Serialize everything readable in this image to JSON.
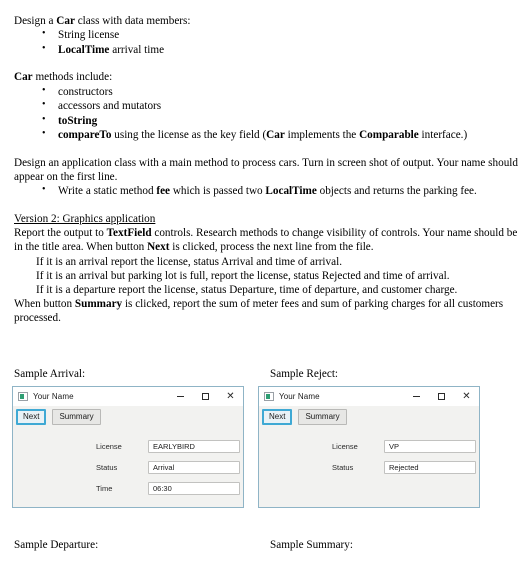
{
  "document": {
    "intro_line": "Design a Car class with data members:",
    "intro_strong": "Car",
    "data_members": [
      {
        "pre": "",
        "strong": "String",
        "post": " license",
        "plain": "String license"
      },
      {
        "strong": "LocalTime",
        "post": " arrival time",
        "plain": "LocalTime arrival time"
      }
    ],
    "methods_heading_strong": "Car",
    "methods_heading": "Car methods include:",
    "methods": [
      {
        "plain": "constructors"
      },
      {
        "plain": "accessors and mutators"
      },
      {
        "plain": "toString"
      },
      {
        "plain": "compareTo using the license as the key field  (Car implements the Comparable interface.)"
      }
    ],
    "app_paragraph": "Design an application class with a main method to process cars. Turn in screen shot of output.  Your name should appear on the first line.",
    "fee_bullet": "Write a static method fee which is passed two LocalTime objects and returns the parking fee.",
    "version2_heading": "Version 2:  Graphics application",
    "version2_para1": "Report the output to TextField controls.  Research methods to change visibility of controls.  Your name should be in the title area. When button Next is clicked, process the next line from the file.",
    "version2_rules": [
      "If it is an arrival report the license, status Arrival and time of arrival.",
      "If it is an arrival but parking lot is full, report the license, status Rejected and time of arrival.",
      "If it is a departure report the license, status Departure, time of departure, and customer charge."
    ],
    "version2_para2": "When button Summary is clicked, report the sum of meter fees and sum of parking charges for all customers processed."
  },
  "captions": {
    "arrival": "Sample Arrival:",
    "reject": "Sample Reject:",
    "departure": "Sample Departure:",
    "summary": "Sample Summary:"
  },
  "windows": {
    "arrival": {
      "title": "Your Name",
      "icon": "app-icon",
      "controls": {
        "minimize": "—",
        "maximize": "□",
        "close": "✕"
      },
      "buttons": {
        "next": "Next",
        "summary": "Summary"
      },
      "fields": [
        {
          "label": "License",
          "value": "EARLYBIRD"
        },
        {
          "label": "Status",
          "value": "Arrival"
        },
        {
          "label": "Time",
          "value": "06:30"
        }
      ]
    },
    "reject": {
      "title": "Your Name",
      "icon": "app-icon",
      "controls": {
        "minimize": "—",
        "maximize": "□",
        "close": "✕"
      },
      "buttons": {
        "next": "Next",
        "summary": "Summary"
      },
      "fields": [
        {
          "label": "License",
          "value": "VP"
        },
        {
          "label": "Status",
          "value": "Rejected"
        }
      ]
    }
  },
  "colors": {
    "window_border": "#8fb4c6",
    "window_bg": "#f2f2f0",
    "titlebar_bg": "#ffffff",
    "focus_border": "#3fa9d4",
    "button_bg": "#e7e7e5",
    "input_bg": "#ffffff",
    "text": "#000000"
  }
}
